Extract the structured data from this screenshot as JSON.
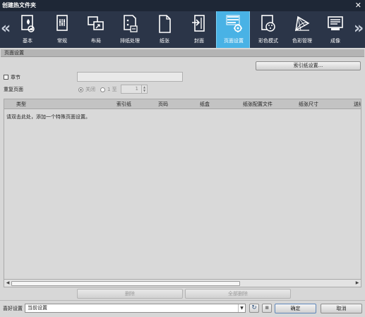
{
  "window": {
    "title": "创建热文件夹"
  },
  "toolbar": {
    "tabs": [
      {
        "label": "基本"
      },
      {
        "label": "常规"
      },
      {
        "label": "布局"
      },
      {
        "label": "排纸处理"
      },
      {
        "label": "纸张"
      },
      {
        "label": "封面"
      },
      {
        "label": "页面设置",
        "active": true
      },
      {
        "label": "彩色模式"
      },
      {
        "label": "色彩管理"
      },
      {
        "label": "成像"
      }
    ],
    "nav_left": "«",
    "nav_right": "»"
  },
  "section": {
    "title": "页面设置"
  },
  "tab_settings_button": "索引纸设置...",
  "chapter": {
    "label": "章节",
    "checked": false,
    "value": ""
  },
  "repeat": {
    "label": "重复页面",
    "off_label": "关闭",
    "one_label": "1 至",
    "count": "1"
  },
  "grid": {
    "columns": [
      "类型",
      "索引纸",
      "页码",
      "纸盒",
      "纸张配置文件",
      "纸张尺寸",
      "送纸"
    ],
    "empty_message": "请双击此处，添加一个特殊页面设置。"
  },
  "actions": {
    "delete": "删除",
    "delete_all": "全部删除"
  },
  "footer": {
    "preset_label": "喜好设置",
    "preset_value": "当前设置",
    "ok": "确定",
    "cancel": "取消"
  },
  "colors": {
    "title_bar": "#1e2736",
    "toolbar": "#2b3548",
    "active_tab": "#49b2e5",
    "panel": "#d7d7d7"
  },
  "icons": [
    "basic-icon",
    "general-icon",
    "layout-icon",
    "finishing-icon",
    "paper-icon",
    "cover-icon",
    "page-settings-icon",
    "color-mode-icon",
    "color-management-icon",
    "imaging-icon",
    "refresh-icon",
    "save-icon"
  ]
}
